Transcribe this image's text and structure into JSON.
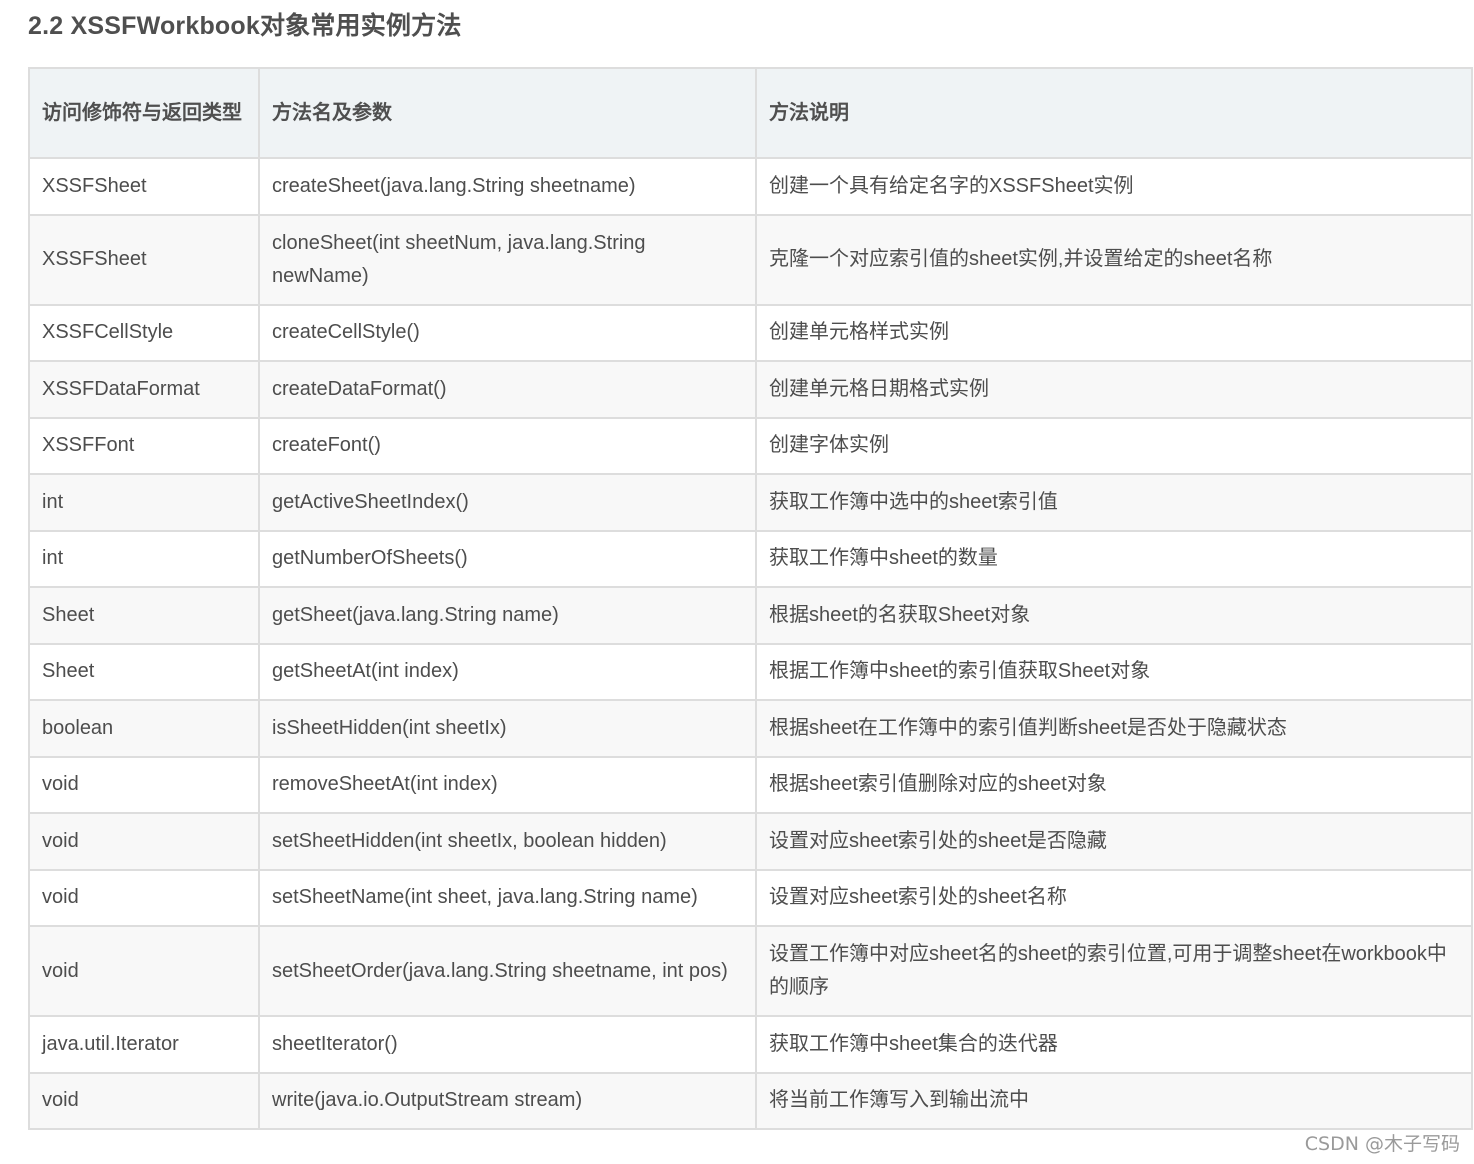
{
  "section": {
    "title": "2.2 XSSFWorkbook对象常用实例方法"
  },
  "table": {
    "headers": [
      "访问修饰符与返回类型",
      "方法名及参数",
      "方法说明"
    ],
    "rows": [
      {
        "type": "XSSFSheet",
        "method": "createSheet(java.lang.String sheetname)",
        "desc": "创建一个具有给定名字的XSSFSheet实例"
      },
      {
        "type": "XSSFSheet",
        "method": "cloneSheet(int sheetNum, java.lang.String newName)",
        "desc": "克隆一个对应索引值的sheet实例,并设置给定的sheet名称"
      },
      {
        "type": "XSSFCellStyle",
        "method": "createCellStyle()",
        "desc": "创建单元格样式实例"
      },
      {
        "type": "XSSFDataFormat",
        "method": "createDataFormat()",
        "desc": "创建单元格日期格式实例"
      },
      {
        "type": "XSSFFont",
        "method": "createFont()",
        "desc": "创建字体实例"
      },
      {
        "type": "int",
        "method": "getActiveSheetIndex()",
        "desc": "获取工作簿中选中的sheet索引值"
      },
      {
        "type": "int",
        "method": "getNumberOfSheets()",
        "desc": "获取工作簿中sheet的数量"
      },
      {
        "type": "Sheet",
        "method": "getSheet(java.lang.String name)",
        "desc": "根据sheet的名获取Sheet对象"
      },
      {
        "type": "Sheet",
        "method": "getSheetAt(int index)",
        "desc": "根据工作簿中sheet的索引值获取Sheet对象"
      },
      {
        "type": "boolean",
        "method": "isSheetHidden(int sheetIx)",
        "desc": "根据sheet在工作簿中的索引值判断sheet是否处于隐藏状态"
      },
      {
        "type": "void",
        "method": "removeSheetAt(int index)",
        "desc": "根据sheet索引值删除对应的sheet对象"
      },
      {
        "type": "void",
        "method": "setSheetHidden(int sheetIx, boolean hidden)",
        "desc": "设置对应sheet索引处的sheet是否隐藏"
      },
      {
        "type": "void",
        "method": "setSheetName(int sheet, java.lang.String name)",
        "desc": "设置对应sheet索引处的sheet名称"
      },
      {
        "type": "void",
        "method": "setSheetOrder(java.lang.String sheetname, int pos)",
        "desc": "设置工作簿中对应sheet名的sheet的索引位置,可用于调整sheet在workbook中的顺序"
      },
      {
        "type": "java.util.Iterator",
        "method": "sheetIterator()",
        "desc": "获取工作簿中sheet集合的迭代器"
      },
      {
        "type": "void",
        "method": "write(java.io.OutputStream stream)",
        "desc": "将当前工作簿写入到输出流中"
      }
    ]
  },
  "watermark": "CSDN @木子写码"
}
